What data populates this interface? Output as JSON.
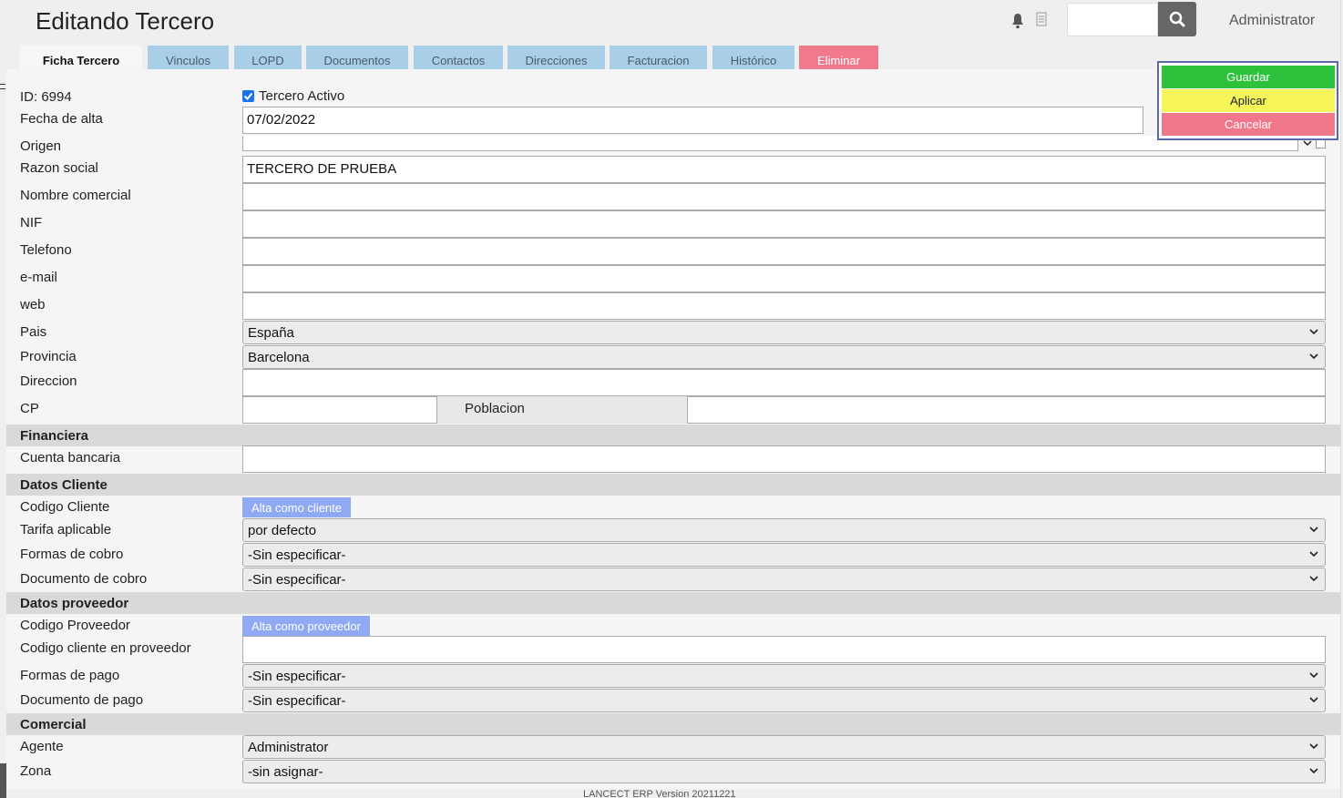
{
  "header": {
    "title": "Editando Tercero",
    "user": "Administrator",
    "search_placeholder": ""
  },
  "tabs": [
    {
      "label": "Ficha Tercero",
      "active": true
    },
    {
      "label": "Vinculos"
    },
    {
      "label": "LOPD"
    },
    {
      "label": "Documentos"
    },
    {
      "label": "Contactos"
    },
    {
      "label": "Direcciones"
    },
    {
      "label": "Facturacion"
    },
    {
      "label": "Histórico"
    },
    {
      "label": "Eliminar",
      "danger": true
    }
  ],
  "actions": {
    "guardar": "Guardar",
    "aplicar": "Aplicar",
    "cancelar": "Cancelar"
  },
  "form": {
    "id_label": "ID: 6994",
    "activo_label": "Tercero Activo",
    "activo_checked": true,
    "fecha_alta_label": "Fecha de alta",
    "fecha_alta_value": "07/02/2022",
    "origen_label": "Origen",
    "razon_social_label": "Razon social",
    "razon_social_value": "TERCERO DE PRUEBA",
    "nombre_comercial_label": "Nombre comercial",
    "nif_label": "NIF",
    "telefono_label": "Telefono",
    "email_label": "e-mail",
    "web_label": "web",
    "pais_label": "Pais",
    "pais_value": "España",
    "provincia_label": "Provincia",
    "provincia_value": "Barcelona",
    "direccion_label": "Direccion",
    "cp_label": "CP",
    "poblacion_label": "Poblacion"
  },
  "financiera": {
    "title": "Financiera",
    "cuenta_label": "Cuenta bancaria"
  },
  "cliente": {
    "title": "Datos Cliente",
    "codigo_label": "Codigo Cliente",
    "alta_button": "Alta como cliente",
    "tarifa_label": "Tarifa aplicable",
    "tarifa_value": "por defecto",
    "formas_cobro_label": "Formas de cobro",
    "formas_cobro_value": "-Sin especificar-",
    "doc_cobro_label": "Documento de cobro",
    "doc_cobro_value": "-Sin especificar-"
  },
  "proveedor": {
    "title": "Datos proveedor",
    "codigo_label": "Codigo Proveedor",
    "alta_button": "Alta como proveedor",
    "codigo_cliente_label": "Codigo cliente en proveedor",
    "formas_pago_label": "Formas de pago",
    "formas_pago_value": "-Sin especificar-",
    "doc_pago_label": "Documento de pago",
    "doc_pago_value": "-Sin especificar-"
  },
  "comercial": {
    "title": "Comercial",
    "agente_label": "Agente",
    "agente_value": "Administrator",
    "zona_label": "Zona",
    "zona_value": "-sin asignar-"
  },
  "footer": "LANCECT ERP Version 20211221"
}
